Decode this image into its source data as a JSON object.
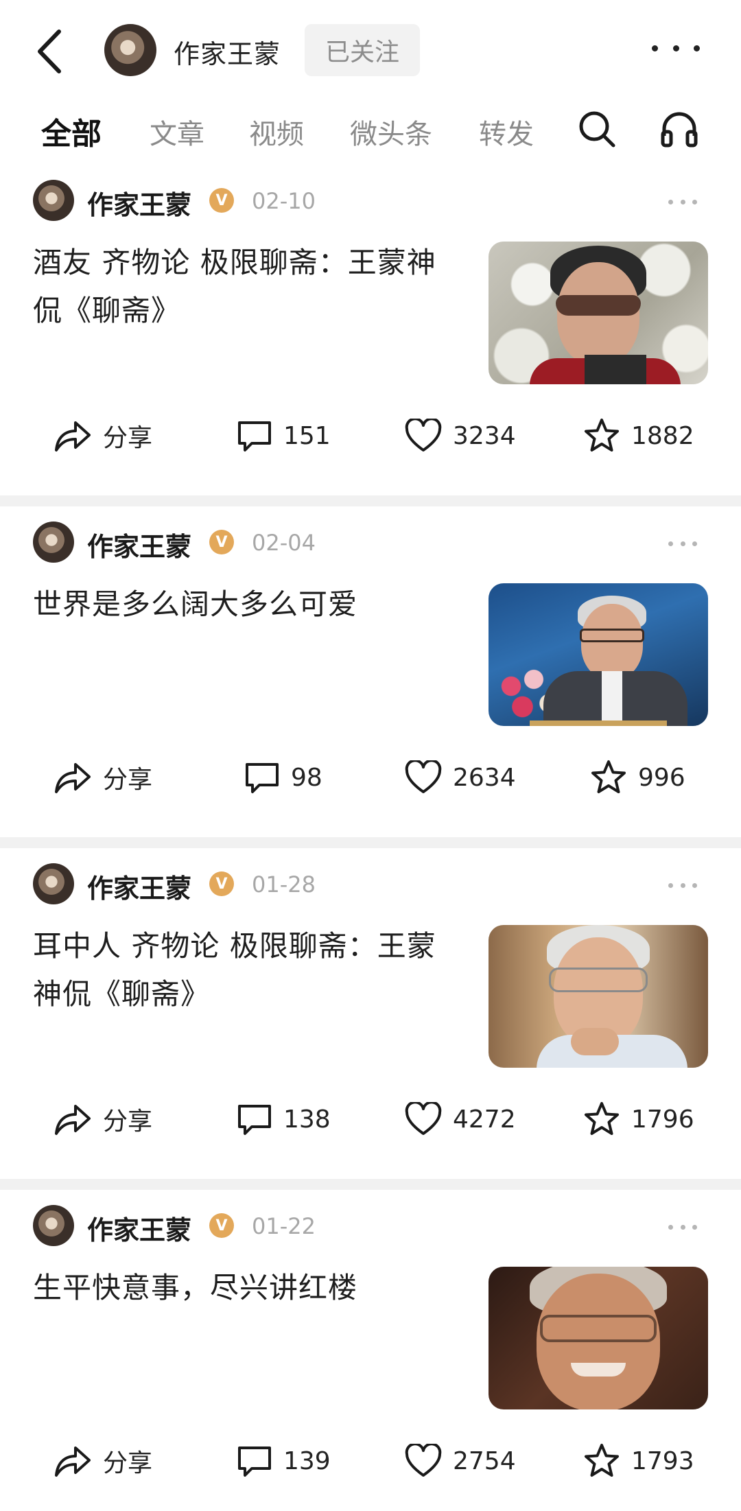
{
  "header": {
    "back_icon": "chevron-left-icon",
    "account_name": "作家王蒙",
    "follow_state": "已关注",
    "more_icon": "more-horizontal-icon"
  },
  "tabs": [
    {
      "label": "全部",
      "active": true
    },
    {
      "label": "文章",
      "active": false
    },
    {
      "label": "视频",
      "active": false
    },
    {
      "label": "微头条",
      "active": false
    },
    {
      "label": "转发",
      "active": false
    }
  ],
  "tab_icons": [
    "search-icon",
    "headphones-icon"
  ],
  "posts": [
    {
      "author": "作家王蒙",
      "verified_badge": "V",
      "date": "02-10",
      "title": "酒友 齐物论 极限聊斋：王蒙神侃《聊斋》",
      "actions": {
        "share": "分享",
        "comments": "151",
        "likes": "3234",
        "favorites": "1882"
      }
    },
    {
      "author": "作家王蒙",
      "verified_badge": "V",
      "date": "02-04",
      "title": "世界是多么阔大多么可爱",
      "actions": {
        "share": "分享",
        "comments": "98",
        "likes": "2634",
        "favorites": "996"
      }
    },
    {
      "author": "作家王蒙",
      "verified_badge": "V",
      "date": "01-28",
      "title": "耳中人 齐物论 极限聊斋：王蒙神侃《聊斋》",
      "actions": {
        "share": "分享",
        "comments": "138",
        "likes": "4272",
        "favorites": "1796"
      }
    },
    {
      "author": "作家王蒙",
      "verified_badge": "V",
      "date": "01-22",
      "title": "生平快意事，尽兴讲红楼",
      "actions": {
        "share": "分享",
        "comments": "139",
        "likes": "2754",
        "favorites": "1793"
      }
    }
  ],
  "colors": {
    "verified_badge": "#e3a85a",
    "separator": "#f1f1f1",
    "muted_text": "#a7a7a7",
    "follow_bg": "#f2f2f2"
  }
}
